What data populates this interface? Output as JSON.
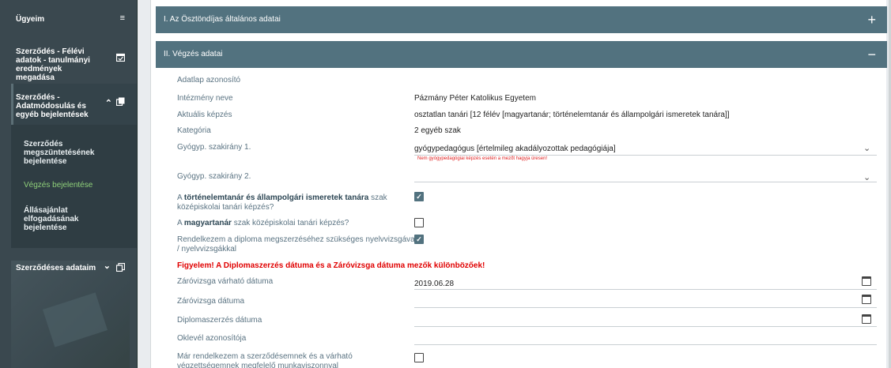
{
  "sidebar": {
    "items": [
      {
        "label": "Ügyeim",
        "icon": "list-icon"
      },
      {
        "label": "Szerződés - Félévi adatok - tanulmányi eredmények megadása",
        "icon": "calendar-check-icon"
      },
      {
        "label": "Szerződés - Adatmódosulás és egyéb bejelentések",
        "icon": "chevron-up-copy-icon"
      },
      {
        "label": "Szerződéses adataim",
        "icon": "chevron-down-copy-icon"
      }
    ],
    "subitems": [
      {
        "label": "Szerződés megszüntetésének bejelentése"
      },
      {
        "label": "Végzés bejelentése",
        "active": true
      },
      {
        "label": "Állásajánlat elfogadásának bejelentése"
      }
    ]
  },
  "sections": {
    "s1": {
      "title": "I. Az Ösztöndíjas általános adatai",
      "toggle": "+"
    },
    "s2": {
      "title": "II. Végzés adatai",
      "toggle": "−"
    }
  },
  "form": {
    "adatlap_label": "Adatlap azonosító",
    "intezmeny_label": "Intézmény neve",
    "intezmeny_value": "Pázmány Péter Katolikus Egyetem",
    "kepzes_label": "Aktuális képzés",
    "kepzes_value": "osztatlan tanári [12 félév [magyartanár; történelemtanár és állampolgári ismeretek tanára]]",
    "kategoria_label": "Kategória",
    "kategoria_value": "2 egyéb szak",
    "szakirany1_label": "Gyógyp. szakirány 1.",
    "szakirany1_value": "gyógypedagógus [értelmileg akadályozottak pedagógiája]",
    "szakirany1_hint": "Nem gyógypedagógiai képzés esetén a mezőt hagyja üresen!",
    "szakirany2_label": "Gyógyp. szakirány 2.",
    "tortenelem_prefix": "A ",
    "tortenelem_bold": "történelemtanár és állampolgári ismeretek tanára",
    "tortenelem_suffix": " szak középiskolai tanári képzés?",
    "magyar_prefix": "A ",
    "magyar_bold": "magyartanár",
    "magyar_suffix": " szak középiskolai tanári képzés?",
    "nyelvvizsga_label": "Rendelkezem a diploma megszerzéséhez szükséges nyelvvizsgával / nyelvvizsgákkal",
    "warning": "Figyelem! A Diplomaszerzés dátuma és a Záróvizsga dátuma mezők különbözőek!",
    "zarovizsga_varhato_label": "Záróvizsga várható dátuma",
    "zarovizsga_varhato_value": "2019.06.28",
    "zarovizsga_label": "Záróvizsga dátuma",
    "diplomaszerzes_label": "Diplomaszerzés dátuma",
    "oklevel_label": "Oklevél azonosítója",
    "munkaviszony_label": "Már rendelkezem a szerződésemnek és a várható végzettségemnek megfelelő munkaviszonnyal",
    "checks": {
      "tortenelem": true,
      "magyar": false,
      "nyelvvizsga": true,
      "munkaviszony": false
    },
    "check_mark": "✓"
  },
  "colors": {
    "header": "#52727f",
    "sidebar": "#3a484f",
    "active": "#8fd07a",
    "warning": "#e00000"
  }
}
